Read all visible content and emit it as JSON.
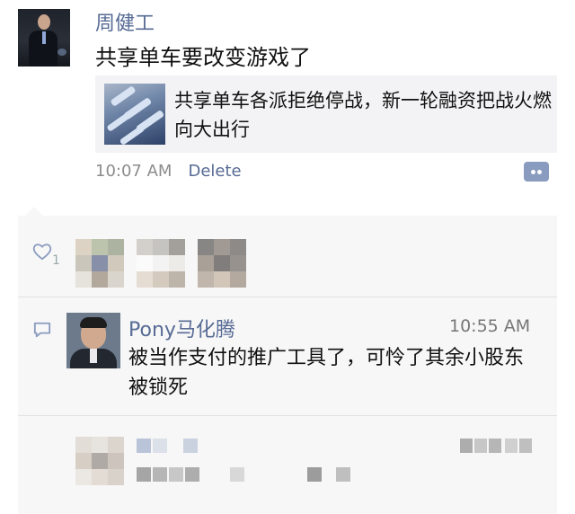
{
  "post": {
    "author": "周健工",
    "text": "共享单车要改变游戏了",
    "share_title": "共享单车各派拒绝停战，新一轮融资把战火燃向大出行",
    "time": "10:07 AM",
    "delete_label": "Delete"
  },
  "likes": {
    "count": "1"
  },
  "comment": {
    "author": "Pony马化腾",
    "time": "10:55 AM",
    "text": "被当作支付的推广工具了，可怜了其余小股东被锁死"
  },
  "colors": {
    "link_blue": "#576b95",
    "panel_bg": "#f7f7f7",
    "card_bg": "#f3f3f5",
    "meta_gray": "#8c8c8c"
  },
  "icons": [
    "heart-icon",
    "comment-bubble-icon",
    "comment-action-icon"
  ]
}
